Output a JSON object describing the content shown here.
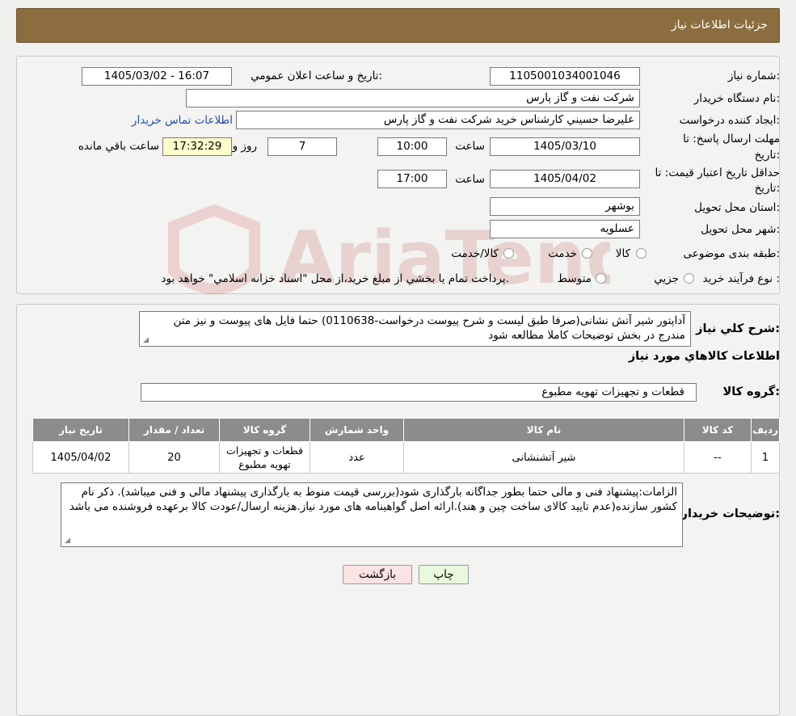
{
  "header": {
    "title": "جزئیات اطلاعات نیاز"
  },
  "form": {
    "need_number_label": "شماره نیاز:",
    "need_number": "1105001034001046",
    "announce_label": "تاریخ و ساعت اعلان عمومي:",
    "announce_value": "1405/03/02 - 16:07",
    "buyer_org_label": "نام دستگاه خريدار:",
    "buyer_org": "شرکت نفت و گاز پارس",
    "creator_label": "ايجاد کننده درخواست:",
    "creator": "عليرضا حسيني کارشناس خريد شرکت نفت و گاز پارس",
    "contact_link": "اطلاعات تماس خريدار",
    "reply_deadline_label_1": "مهلت ارسال پاسخ: تا",
    "reply_deadline_label_2": "تاريخ:",
    "reply_date": "1405/03/10",
    "time_label": "ساعت",
    "reply_time": "10:00",
    "days": "7",
    "days_label": "روز و",
    "remaining_time": "17:32:29",
    "remaining_label": "ساعت باقي مانده",
    "validity_label_1": "حداقل تاريخ اعتبار قيمت: تا",
    "validity_label_2": "تاريخ:",
    "validity_date": "1405/04/02",
    "validity_time": "17:00",
    "province_label": "استان محل تحويل:",
    "province": "بوشهر",
    "city_label": "شهر محل تحويل:",
    "city": "عسلويه",
    "category_label": "طبقه بندی موضوعی:",
    "category_options": [
      "کالا",
      "خدمت",
      "کالا/خدمت"
    ],
    "process_label": "نوع فرآيند خريد :",
    "process_options": [
      "جزيي",
      "متوسط"
    ],
    "process_note": "پرداخت تمام يا بخشي از مبلغ خريد،از محل \"اسناد خزانه اسلامي\" خواهد بود."
  },
  "summary": {
    "label": "شرح کلي نياز:",
    "text": "آداپتور شیر آتش نشانی(صرفا طبق لیست و شرح پیوست درخواست-0110638) حتما فایل های پیوست و نیز متن مندرج در بخش توضیحات کاملا مطالعه شود",
    "goods_info_title": "اطلاعات کالاهاي مورد نياز",
    "goods_group_label": "گروه کالا:",
    "goods_group": "قطعات و تجهيزات تهويه مطبوع"
  },
  "table": {
    "headers": [
      "رديف",
      "کد کالا",
      "نام کالا",
      "واحد شمارش",
      "گروه کالا",
      "تعداد / مقدار",
      "تاريخ نياز"
    ],
    "rows": [
      [
        "1",
        "--",
        "شير آتشنشانی",
        "عدد",
        "قطعات و تجهيزات تهويه مطبوع",
        "20",
        "1405/04/02"
      ]
    ]
  },
  "notes": {
    "label": "توضيحات خريدار:",
    "text": "الزامات:پیشنهاد فنی و مالی حتما  بطور جداگانه بارگذاری شود(بررسی قیمت منوط به بارگذاری پیشنهاد مالی و فنی میباشد). ذکر نام کشور سازنده(عدم تایید کالای ساخت چین و هند).ارائه اصل گواهینامه های مورد نیاز.هزینه ارسال/عودت کالا برعهده فروشنده می باشد"
  },
  "buttons": {
    "print": "چاپ",
    "back": "بازگشت"
  },
  "colors": {
    "header_bg": "#8c6d3f",
    "table_header_bg": "#8c8c8c",
    "remaining_bg": "#ffffcc",
    "print_bg": "#e9f8df",
    "back_bg": "#fbe3e3"
  }
}
